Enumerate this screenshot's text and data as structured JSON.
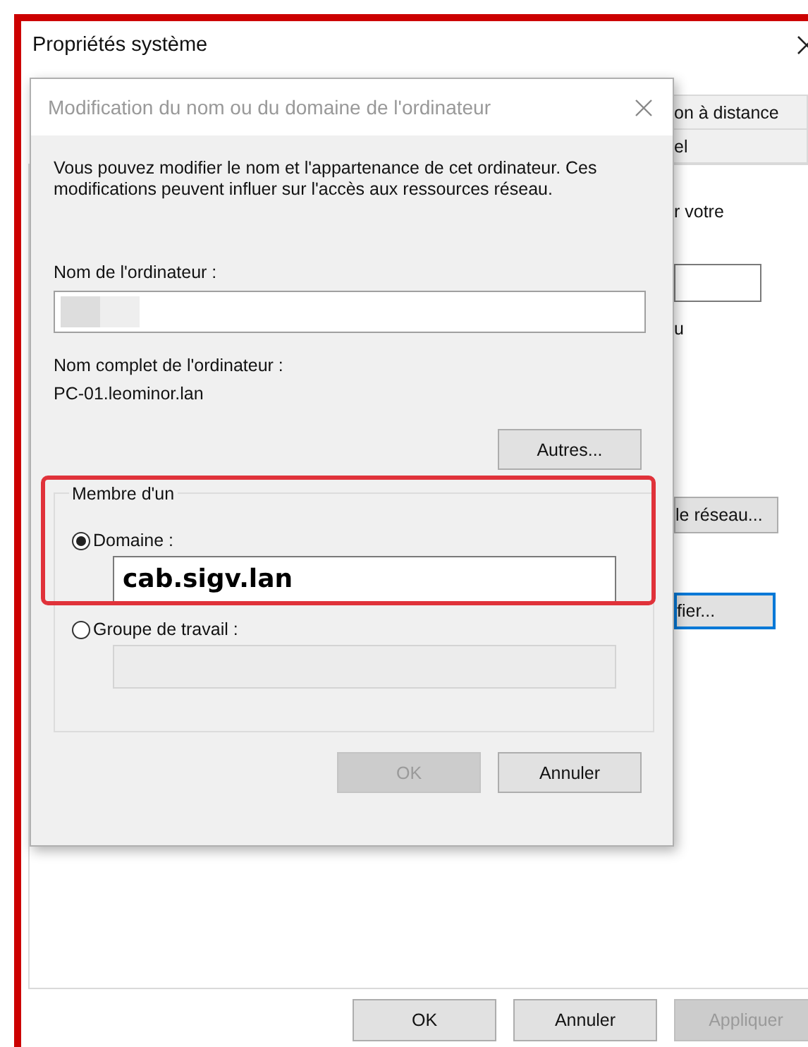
{
  "window": {
    "title": "Propriétés système"
  },
  "tabs": [
    {
      "label": "on à distance",
      "selected": false
    },
    {
      "label": "el",
      "selected": false
    }
  ],
  "panel": {
    "texts": [
      "r votre",
      "u"
    ],
    "buttons": [
      {
        "label": "le réseau...",
        "default": false
      },
      {
        "label": "fier...",
        "default": true
      }
    ]
  },
  "buttons": [
    {
      "label": "OK",
      "disabled": false
    },
    {
      "label": "Annuler",
      "disabled": false
    },
    {
      "label": "Appliquer",
      "disabled": true
    }
  ],
  "dialog": {
    "title": "Modification du nom ou du domaine de l'ordinateur",
    "description": "Vous pouvez modifier le nom et l'appartenance de cet ordinateur. Ces modifications peuvent influer sur l'accès aux ressources réseau.",
    "computer_name_label": "Nom de l'ordinateur :",
    "full_name_label": "Nom complet de l'ordinateur :",
    "full_name": "PC-01.leominor.lan",
    "more_button": "Autres...",
    "member_of": {
      "legend": "Membre d'un",
      "highlighted": true,
      "options": [
        {
          "label": "Domaine :",
          "selected": true,
          "value": "cab.sigv.lan"
        },
        {
          "label": "Groupe de travail :",
          "selected": false
        }
      ]
    },
    "buttons": [
      {
        "label": "OK",
        "disabled": true
      },
      {
        "label": "Annuler",
        "disabled": false
      }
    ]
  }
}
